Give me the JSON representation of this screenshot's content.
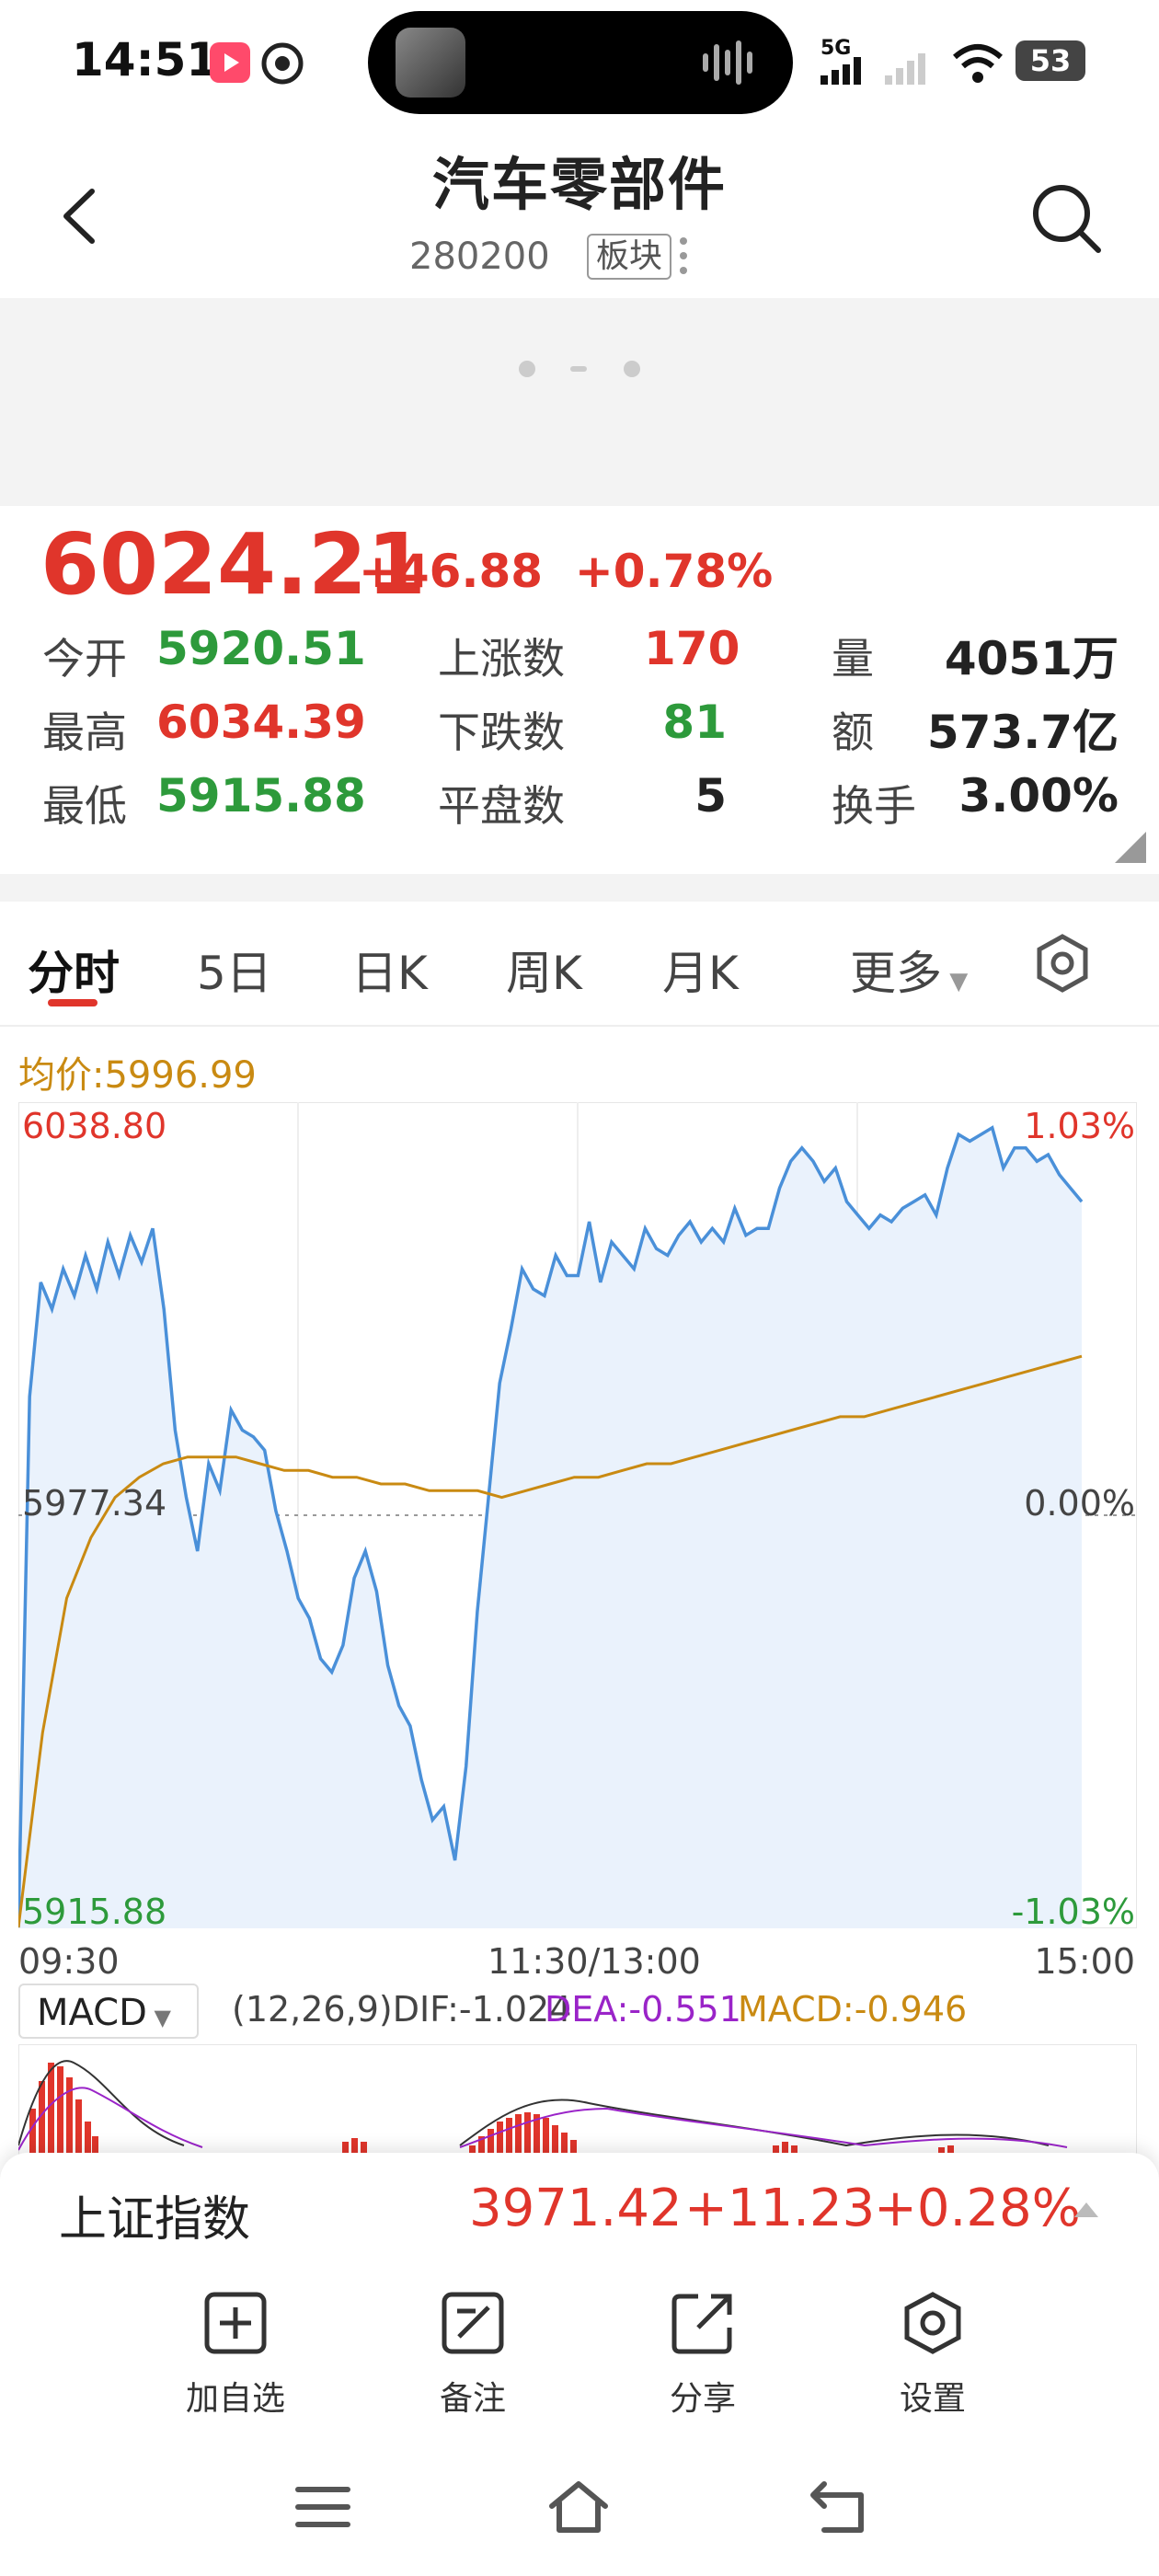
{
  "status_bar": {
    "time": "14:51",
    "network": "5G",
    "battery": "53"
  },
  "header": {
    "title": "汽车零部件",
    "code": "280200",
    "board_tag": "板块"
  },
  "quote": {
    "price": "6024.21",
    "change": "+46.88",
    "change_pct": "+0.78%",
    "rows": [
      {
        "l1": "今开",
        "v1": "5920.51",
        "l2": "上涨数",
        "v2": "170",
        "l3": "量",
        "v3": "4051万"
      },
      {
        "l1": "最高",
        "v1": "6034.39",
        "l2": "下跌数",
        "v2": "81",
        "l3": "额",
        "v3": "573.7亿"
      },
      {
        "l1": "最低",
        "v1": "5915.88",
        "l2": "平盘数",
        "v2": "5",
        "l3": "换手",
        "v3": "3.00%"
      }
    ]
  },
  "tabs": [
    "分时",
    "5日",
    "日K",
    "周K",
    "月K",
    "更多"
  ],
  "chart_data": {
    "type": "line",
    "avg_price_label": "均价:5996.99",
    "y_top_label": "6038.80",
    "y_mid_label": "5977.34",
    "y_bottom_label": "5915.88",
    "pct_top_label": "1.03%",
    "pct_mid_label": "0.00%",
    "pct_bottom_label": "-1.03%",
    "x_labels": [
      "09:30",
      "11:30/13:00",
      "15:00"
    ],
    "ylim": [
      5915.88,
      6038.8
    ],
    "series": [
      {
        "name": "price",
        "color": "#4a90d9",
        "values": [
          5916,
          5995,
          6012,
          6008,
          6014,
          6010,
          6016,
          6011,
          6018,
          6013,
          6019,
          6015,
          6020,
          6008,
          5990,
          5980,
          5972,
          5985,
          5981,
          5993,
          5990,
          5989,
          5987,
          5978,
          5972,
          5965,
          5962,
          5956,
          5954,
          5958,
          5968,
          5972,
          5966,
          5955,
          5949,
          5946,
          5938,
          5932,
          5934,
          5926,
          5940,
          5963,
          5980,
          5997,
          6005,
          6014,
          6011,
          6010,
          6016,
          6013,
          6013,
          6021,
          6012,
          6018,
          6016,
          6014,
          6020,
          6017,
          6016,
          6019,
          6021,
          6018,
          6020,
          6018,
          6023,
          6019,
          6020,
          6020,
          6026,
          6030,
          6032,
          6030,
          6027,
          6029,
          6024,
          6022,
          6020,
          6022,
          6021,
          6023,
          6024,
          6025,
          6022,
          6029,
          6034,
          6033,
          6034,
          6035,
          6029,
          6032,
          6032,
          6030,
          6031,
          6028,
          6026,
          6024
        ]
      },
      {
        "name": "avg",
        "color": "#c98a12",
        "values": [
          5916,
          5945,
          5965,
          5974,
          5980,
          5983,
          5985,
          5986,
          5986,
          5986,
          5985,
          5984,
          5984,
          5983,
          5983,
          5982,
          5982,
          5981,
          5981,
          5981,
          5980,
          5981,
          5982,
          5983,
          5983,
          5984,
          5985,
          5985,
          5986,
          5987,
          5988,
          5989,
          5990,
          5991,
          5992,
          5992,
          5993,
          5994,
          5995,
          5996,
          5997,
          5998,
          5999,
          6000,
          6001
        ]
      }
    ]
  },
  "macd": {
    "selector": "MACD",
    "params": "(12,26,9)DIF:-1.024",
    "dea": "DEA:-0.551",
    "macd": "MACD:-0.946"
  },
  "index_bar": {
    "name": "上证指数",
    "value": "3971.42",
    "change": "+11.23",
    "change_pct": "+0.28%"
  },
  "actions": [
    "加自选",
    "备注",
    "分享",
    "设置"
  ],
  "colors": {
    "up": "#e0352b",
    "down": "#2d9a3b",
    "line": "#4a90d9",
    "avg": "#c98a12"
  }
}
